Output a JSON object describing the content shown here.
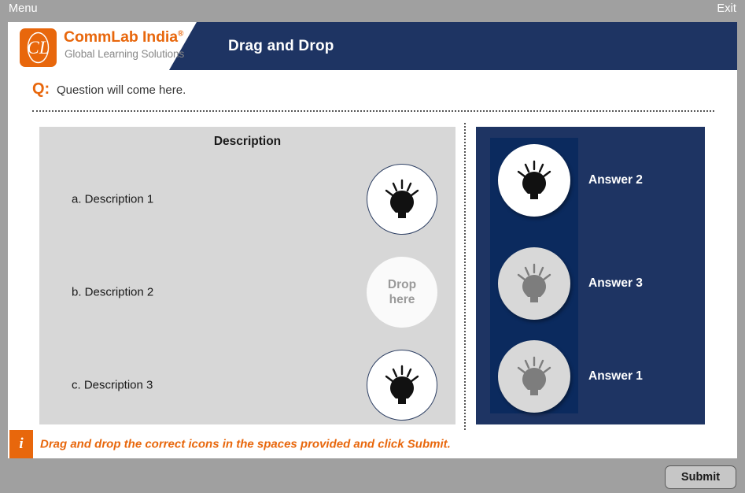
{
  "topbar": {
    "menu_label": "Menu",
    "exit_label": "Exit"
  },
  "branding": {
    "logo_mark_text": "CL",
    "company_name": "CommLab India",
    "registered_symbol": "®",
    "tagline": "Global Learning Solutions"
  },
  "header": {
    "title": "Drag and Drop"
  },
  "question": {
    "prefix": "Q:",
    "text": "Question will come here."
  },
  "description_panel": {
    "title": "Description",
    "rows": [
      {
        "label": "a. Description 1",
        "slot_state": "filled",
        "drop_placeholder": ""
      },
      {
        "label": "b. Description 2",
        "slot_state": "empty",
        "drop_placeholder_line1": "Drop",
        "drop_placeholder_line2": "here"
      },
      {
        "label": "c. Description 3",
        "slot_state": "filled",
        "drop_placeholder": ""
      }
    ]
  },
  "answer_panel": {
    "options": [
      {
        "label": "Answer 2",
        "state": "active"
      },
      {
        "label": "Answer 3",
        "state": "used"
      },
      {
        "label": "Answer 1",
        "state": "used"
      }
    ]
  },
  "instruction": {
    "badge": "i",
    "text": "Drag and drop the correct icons in the spaces provided and click Submit."
  },
  "footer": {
    "submit_label": "Submit"
  },
  "colors": {
    "navy": "#1e3463",
    "navy_dark": "#0b2a5e",
    "orange": "#e8670c",
    "chrome_gray": "#a0a0a0",
    "panel_gray": "#d7d7d7"
  }
}
